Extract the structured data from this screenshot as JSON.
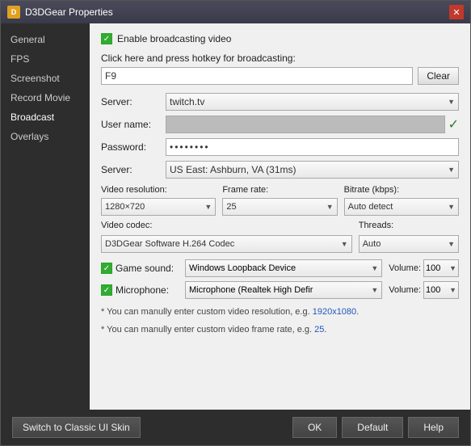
{
  "window": {
    "title": "D3DGear Properties",
    "icon": "D"
  },
  "sidebar": {
    "items": [
      {
        "label": "General",
        "active": false
      },
      {
        "label": "FPS",
        "active": false
      },
      {
        "label": "Screenshot",
        "active": false
      },
      {
        "label": "Record Movie",
        "active": false
      },
      {
        "label": "Broadcast",
        "active": true
      },
      {
        "label": "Overlays",
        "active": false
      }
    ]
  },
  "content": {
    "enable_checkbox": true,
    "enable_label": "Enable broadcasting video",
    "hotkey_label": "Click here and press hotkey for broadcasting:",
    "hotkey_value": "F9",
    "clear_button": "Clear",
    "server_label": "Server:",
    "server_value": "twitch.tv",
    "username_label": "User name:",
    "password_label": "Password:",
    "password_value": "••••••••",
    "server2_label": "Server:",
    "server2_value": "US East: Ashburn, VA   (31ms)",
    "video_res_label": "Video resolution:",
    "video_res_value": "1280×720",
    "frame_rate_label": "Frame rate:",
    "frame_rate_value": "25",
    "bitrate_label": "Bitrate (kbps):",
    "bitrate_value": "Auto detect",
    "codec_label": "Video codec:",
    "codec_value": "D3DGear Software H.264 Codec",
    "threads_label": "Threads:",
    "threads_value": "Auto",
    "game_sound_label": "Game sound:",
    "game_sound_value": "Windows Loopback Device",
    "game_volume_label": "Volume:",
    "game_volume_value": "100",
    "mic_label": "Microphone:",
    "mic_value": "Microphone (Realtek High Defir",
    "mic_volume_label": "Volume:",
    "mic_volume_value": "100",
    "note1": "* You can manully enter custom video resolution, e.g. 1920x1080.",
    "note1_link": "1920x1080",
    "note2": "* You can manully enter custom video frame rate, e.g. 25.",
    "note2_link": "25"
  },
  "footer": {
    "classic_skin": "Switch to Classic UI Skin",
    "ok": "OK",
    "default": "Default",
    "help": "Help"
  }
}
